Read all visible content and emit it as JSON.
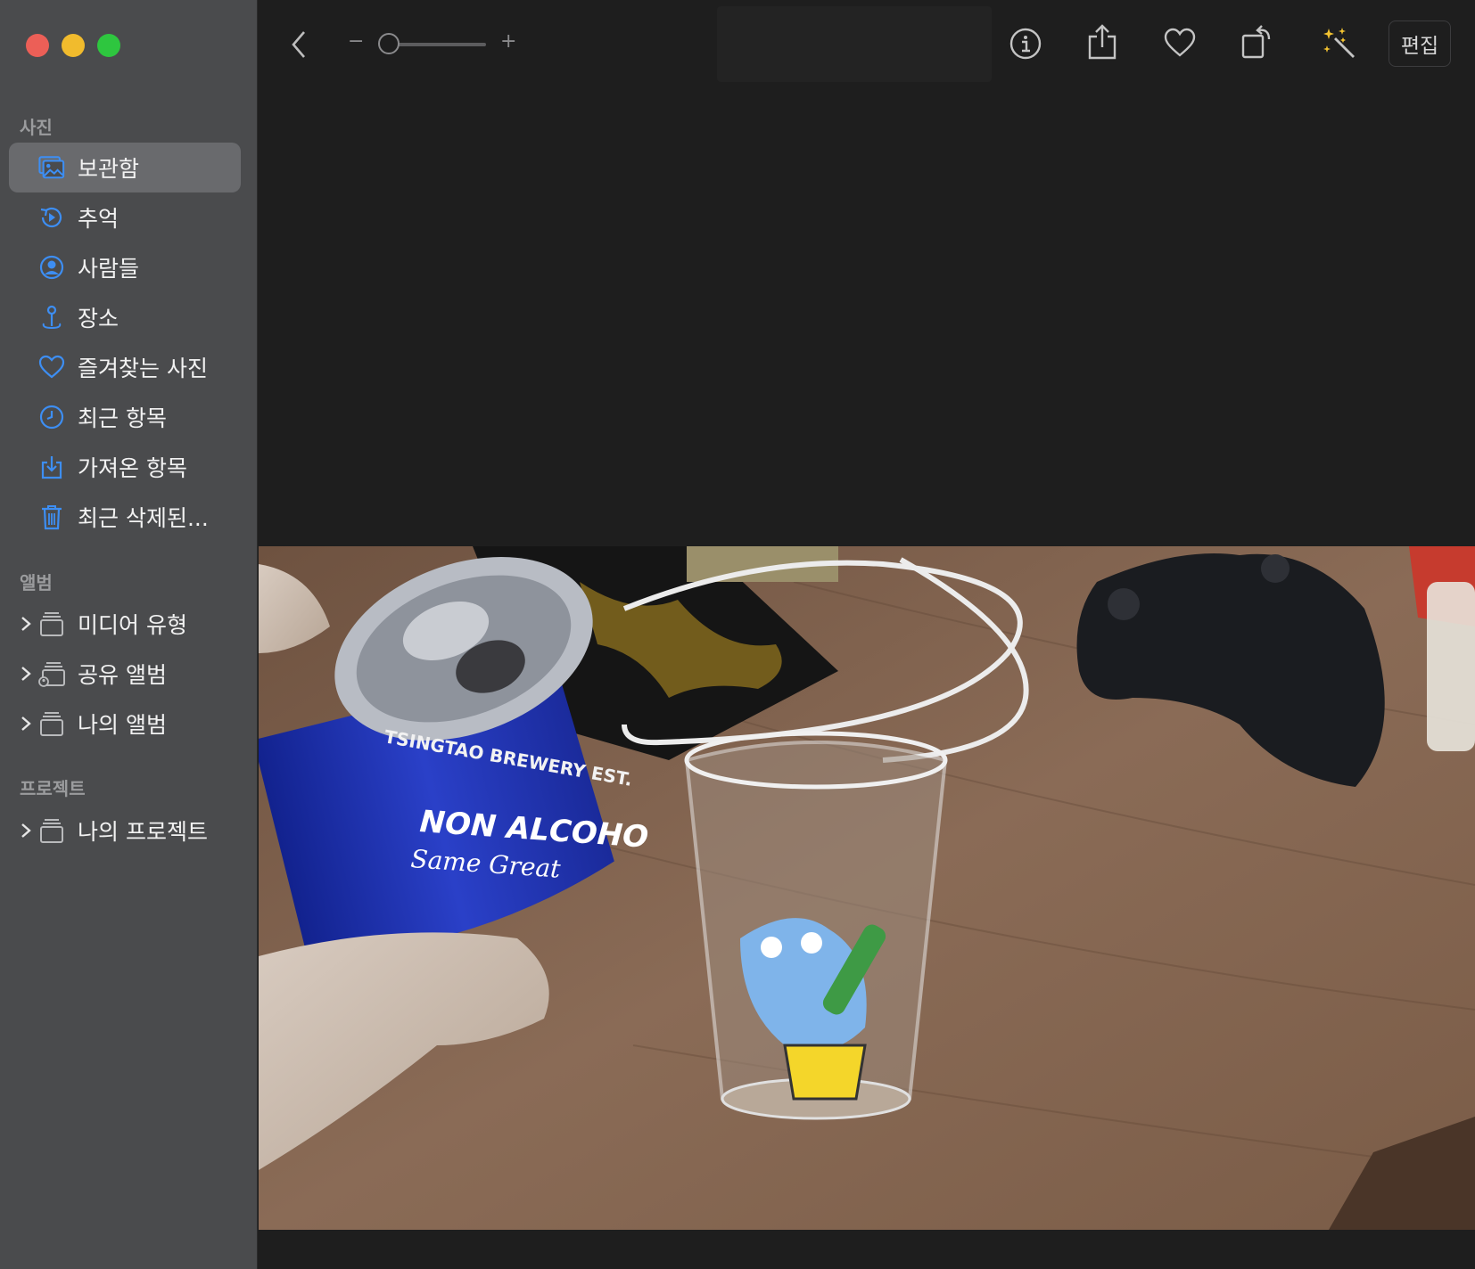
{
  "sidebar": {
    "section_photos": "사진",
    "photos_items": [
      {
        "label": "보관함",
        "icon": "photo-library-icon",
        "selected": true
      },
      {
        "label": "추억",
        "icon": "memories-icon"
      },
      {
        "label": "사람들",
        "icon": "people-icon"
      },
      {
        "label": "장소",
        "icon": "places-pin-icon"
      },
      {
        "label": "즐겨찾는 사진",
        "icon": "heart-icon"
      },
      {
        "label": "최근 항목",
        "icon": "clock-icon"
      },
      {
        "label": "가져온 항목",
        "icon": "import-icon"
      },
      {
        "label": "최근 삭제된...",
        "icon": "trash-icon"
      }
    ],
    "section_albums": "앨범",
    "album_items": [
      {
        "label": "미디어 유형",
        "icon": "album-stack-icon"
      },
      {
        "label": "공유 앨범",
        "icon": "shared-album-icon"
      },
      {
        "label": "나의 앨범",
        "icon": "album-stack-icon"
      }
    ],
    "section_projects": "프로젝트",
    "project_items": [
      {
        "label": "나의 프로젝트",
        "icon": "album-stack-icon"
      }
    ]
  },
  "toolbar": {
    "zoom_minus": "−",
    "zoom_plus": "+",
    "zoom_level": 0.05,
    "edit_label": "편집"
  },
  "photo": {
    "can_text_1": "TSINGTAO BREWERY EST.",
    "can_text_2": "NON ALCOHO",
    "can_text_3": "Same Great"
  },
  "colors": {
    "sidebar_bg": "#4a4b4d",
    "content_bg": "#1e1e1e",
    "accent_blue": "#3d8ef3",
    "selected_bg": "#696a6d"
  }
}
